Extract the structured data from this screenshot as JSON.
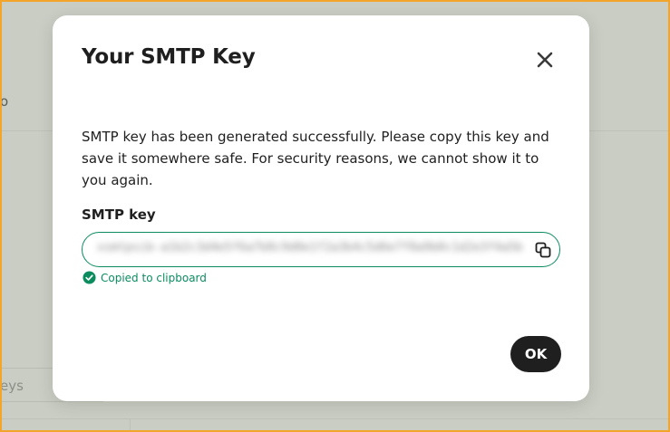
{
  "background": {
    "fragment_text": "o",
    "input_text": "eys"
  },
  "modal": {
    "title": "Your SMTP Key",
    "close_icon": "close-icon",
    "description": "SMTP key has been generated successfully. Please copy this key and save it somewhere safe. For security reasons, we cannot show it to you again.",
    "field_label": "SMTP key",
    "key_value": "xsmtpsib-a1b2c3d4e5f6a7b8c9d0e1f2a3b4c5d6e7f8a9b0c1d2e3f4a5b6c7d8e9f0a1b2-Xy",
    "copy_icon": "copy-icon",
    "copied_icon": "check-circle-icon",
    "copied_text": "Copied to clipboard",
    "ok_label": "OK"
  },
  "colors": {
    "accent_green": "#0b8c5f",
    "button_dark": "#1f1f1f",
    "overlay": "#c9cdc3",
    "frame_border": "#f2a42b"
  }
}
